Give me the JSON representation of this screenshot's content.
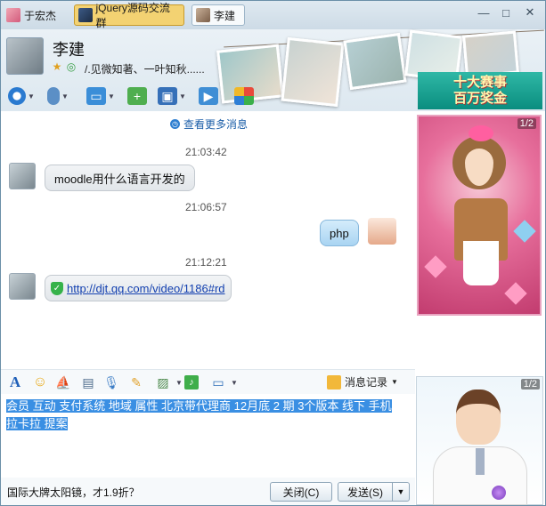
{
  "tabs": [
    {
      "label": "于宏杰"
    },
    {
      "label": "jQuery源码交流群"
    },
    {
      "label": "李建"
    }
  ],
  "window_controls": {
    "minimize": "—",
    "maximize": "□",
    "close": "✕"
  },
  "contact": {
    "name": "李建",
    "signature": "/.见微知著、一叶知秋......"
  },
  "toolbar_icons": [
    "video-icon",
    "voice-icon",
    "file-transfer-icon",
    "add-contact-icon",
    "remote-desktop-icon",
    "share-screen-icon",
    "apps-icon"
  ],
  "ad_banner": {
    "line1": "十大赛事",
    "line2": "百万奖金"
  },
  "show_panel": {
    "counter": "1/2"
  },
  "boy_panel": {
    "counter": "1/2"
  },
  "chat": {
    "more_messages": "查看更多消息",
    "messages": [
      {
        "time": "21:03:42",
        "direction": "in",
        "text": "moodle用什么语言开发的"
      },
      {
        "time": "21:06:57",
        "direction": "out",
        "text": "php"
      },
      {
        "time": "21:12:21",
        "direction": "in",
        "text": "http://djt.qq.com/video/1186#rd"
      }
    ]
  },
  "input_toolbar": {
    "icons": [
      "font-icon",
      "emoji-icon",
      "magic-icon",
      "rich-text-icon",
      "voice-message-icon",
      "scratchpad-icon",
      "image-icon",
      "music-icon",
      "screenshot-icon"
    ],
    "history_label": "消息记录"
  },
  "input": {
    "text_line1": "会员 互动 支付系统 地域 属性  北京带代理商 12月底 2 期 3个版本 线下 手机",
    "text_line2": "拉卡拉 提案"
  },
  "bottom": {
    "ad_text": "国际大牌太阳镜，才1.9折？",
    "close_label": "关闭(C)",
    "send_label": "发送(S)",
    "send_dropdown": "▼"
  }
}
